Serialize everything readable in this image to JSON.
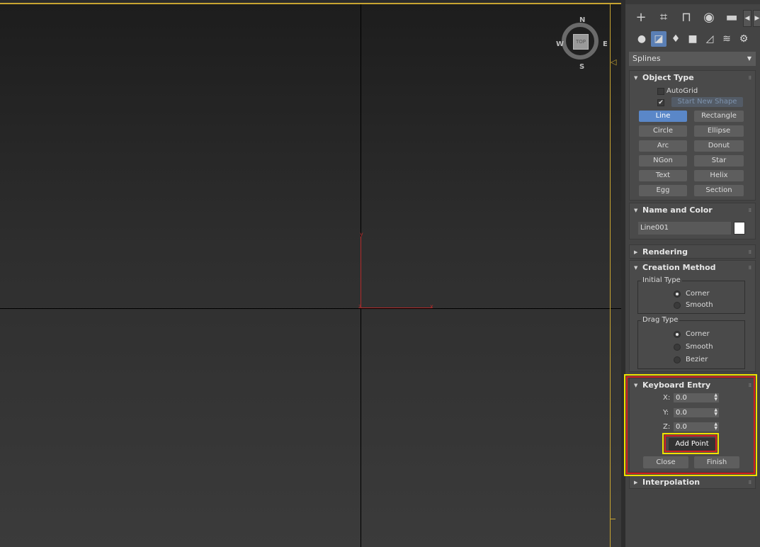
{
  "viewport": {
    "compass": {
      "n": "N",
      "s": "S",
      "e": "E",
      "w": "W"
    },
    "cube_label": "TOP",
    "axis_labels": {
      "y": "y",
      "x": "x",
      "z": "z"
    }
  },
  "panel": {
    "tabs": [
      {
        "name": "create",
        "glyph": "+"
      },
      {
        "name": "modify",
        "glyph": "⌗"
      },
      {
        "name": "hierarchy",
        "glyph": "⊓"
      },
      {
        "name": "motion",
        "glyph": "◉"
      },
      {
        "name": "display",
        "glyph": "▬"
      }
    ],
    "subtabs": [
      {
        "name": "geometry",
        "glyph": "●"
      },
      {
        "name": "shapes",
        "glyph": "◪"
      },
      {
        "name": "lights",
        "glyph": "♦"
      },
      {
        "name": "cameras",
        "glyph": "■"
      },
      {
        "name": "helpers",
        "glyph": "◿"
      },
      {
        "name": "space-warps",
        "glyph": "≋"
      },
      {
        "name": "systems",
        "glyph": "⚙"
      }
    ],
    "category_dropdown": "Splines",
    "object_type": {
      "title": "Object Type",
      "autogrid_label": "AutoGrid",
      "start_new_shape_label": "Start New Shape",
      "start_new_shape_check": "✔",
      "buttons": [
        "Line",
        "Rectangle",
        "Circle",
        "Ellipse",
        "Arc",
        "Donut",
        "NGon",
        "Star",
        "Text",
        "Helix",
        "Egg",
        "Section"
      ]
    },
    "name_and_color": {
      "title": "Name and Color",
      "name_value": "Line001",
      "color": "#ffffff"
    },
    "rendering": {
      "title": "Rendering"
    },
    "creation_method": {
      "title": "Creation Method",
      "initial_type_label": "Initial Type",
      "initial_corner": "Corner",
      "initial_smooth": "Smooth",
      "drag_type_label": "Drag Type",
      "drag_corner": "Corner",
      "drag_smooth": "Smooth",
      "drag_bezier": "Bezier"
    },
    "keyboard_entry": {
      "title": "Keyboard Entry",
      "x_label": "X:",
      "x_value": "0.0",
      "y_label": "Y:",
      "y_value": "0.0",
      "z_label": "Z:",
      "z_value": "0.0",
      "add_point": "Add Point",
      "close": "Close",
      "finish": "Finish"
    },
    "interpolation": {
      "title": "Interpolation"
    }
  }
}
